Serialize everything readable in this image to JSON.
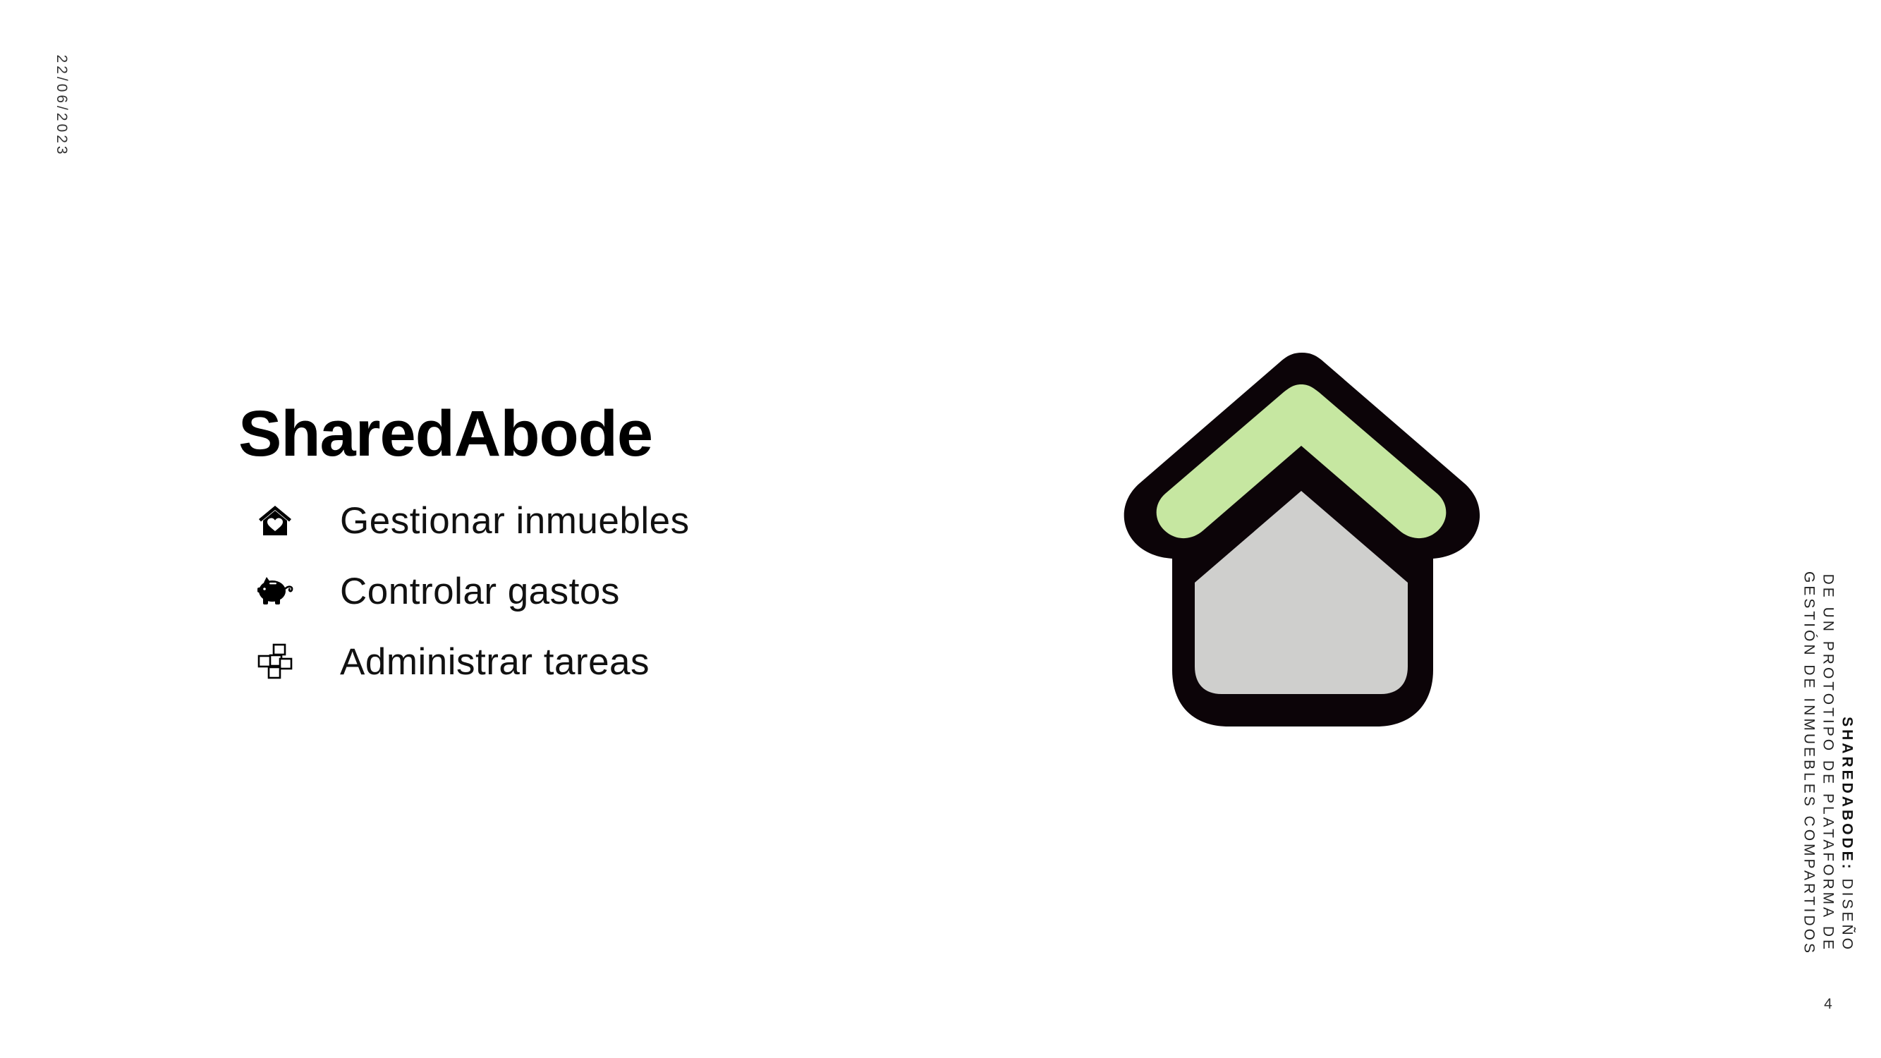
{
  "slide": {
    "date": "22/06/2023",
    "title": "SharedAbode",
    "features": [
      {
        "icon": "house-heart-icon",
        "label": "Gestionar inmuebles"
      },
      {
        "icon": "piggy-bank-icon",
        "label": "Controlar gastos"
      },
      {
        "icon": "tasks-blocks-icon",
        "label": "Administrar tareas"
      }
    ],
    "logo": {
      "icon": "sharedabode-house-logo",
      "colors": {
        "roof": "#c6e7a1",
        "body": "#cfcfcd",
        "outline": "#0c0408"
      }
    },
    "footer": {
      "brand": "SHAREDABODE:",
      "line1_rest": " DISEÑO",
      "line2": "DE UN PROTOTIPO DE PLATAFORMA DE",
      "line3": "GESTIÓN DE INMUEBLES COMPARTIDOS"
    },
    "page_number": "4"
  }
}
